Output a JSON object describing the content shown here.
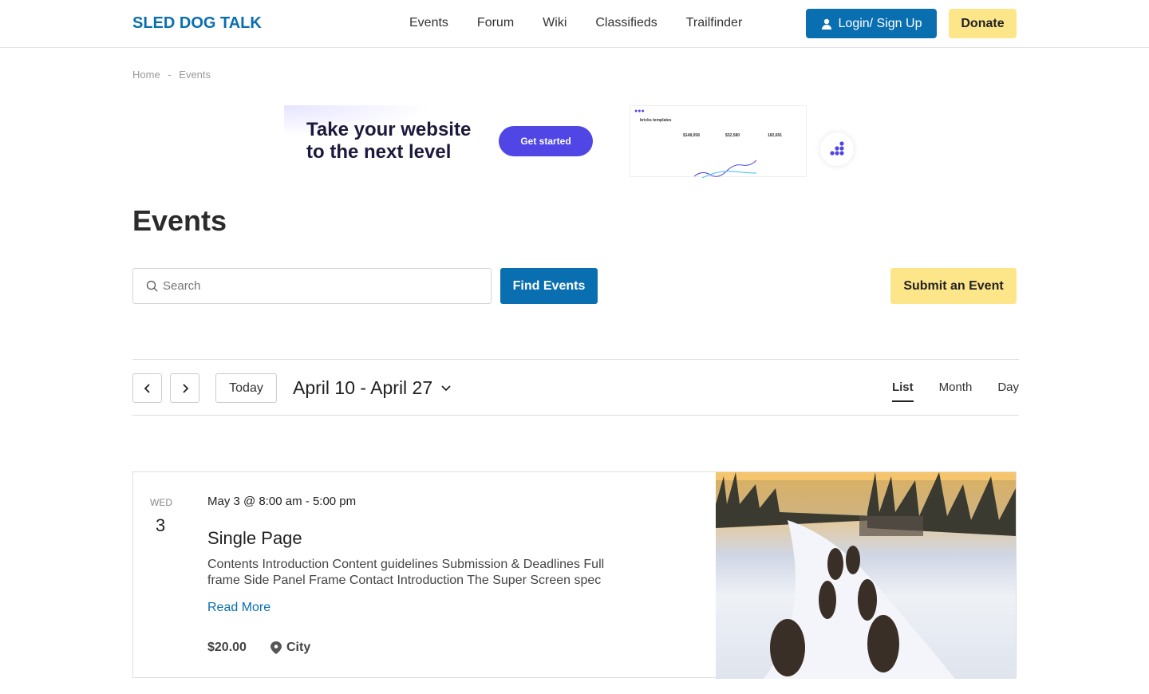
{
  "header": {
    "logo": "SLED DOG TALK",
    "nav": [
      "Events",
      "Forum",
      "Wiki",
      "Classifieds",
      "Trailfinder"
    ],
    "login": "Login/ Sign Up",
    "donate": "Donate"
  },
  "breadcrumb": {
    "home": "Home",
    "sep": "-",
    "current": "Events"
  },
  "banner": {
    "line1": "Take your website",
    "line2": "to the next level",
    "button": "Get started",
    "dash_brand": "bricks templates",
    "stats": [
      "$148,058",
      "$32,580",
      "182,691"
    ]
  },
  "page": {
    "title": "Events"
  },
  "search": {
    "placeholder": "Search",
    "find": "Find Events",
    "submit": "Submit an Event"
  },
  "calendar": {
    "today": "Today",
    "range": "April 10 - April 27",
    "views": [
      "List",
      "Month",
      "Day"
    ],
    "active_view": "List"
  },
  "event": {
    "dow": "WED",
    "day": "3",
    "when": "May 3 @ 8:00 am - 5:00 pm",
    "title": "Single Page",
    "description": "Contents Introduction Content guidelines Submission & Deadlines Full frame Side Panel Frame Contact Introduction The Super Screen spec",
    "read_more": "Read More",
    "price": "$20.00",
    "location": "City"
  },
  "colors": {
    "primary": "#0a6fb0",
    "accent": "#fde68a",
    "banner_button": "#4f46e5"
  }
}
